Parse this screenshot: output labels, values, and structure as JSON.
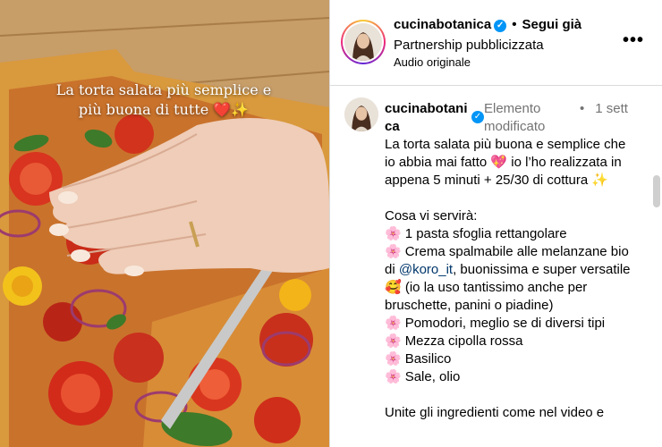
{
  "media": {
    "overlay_caption": "La torta salata più semplice e più buona di tutte ❤️✨"
  },
  "header": {
    "username": "cucinabotanica",
    "verified_icon": "✓",
    "separator": "•",
    "follow_label": "Segui già",
    "subtitle": "Partnership pubblicizzata",
    "audio": "Audio originale",
    "more_icon": "•••"
  },
  "comment": {
    "username": "cucinabotanica",
    "verified_icon": "✓",
    "edited": "Elemento modificato",
    "dot": "•",
    "time": "1 sett",
    "intro_1": "La torta salata più buona e semplice che io abbia mai fatto ",
    "intro_heart": "💖",
    "intro_2": " io l’ho realizzata in appena 5 minuti + 25/30 di cottura ",
    "intro_spark": "✨",
    "needs_title": "Cosa vi servirà:",
    "flower_icon": "🌸",
    "item_1": "1 pasta sfoglia rettangolare",
    "item_2a": "Crema spalmabile alle melanzane bio di ",
    "item_2_mention": "@koro_it",
    "item_2b": ", buonissima e super versatile ",
    "item_2_emoji": "🥰",
    "item_2c": " (io la uso tantissimo anche per bruschette, panini o piadine)",
    "item_3": "Pomodori, meglio se di diversi tipi",
    "item_4": "Mezza cipolla rossa",
    "item_5": "Basilico",
    "item_6": "Sale, olio",
    "outro": "Unite gli ingredienti come nel video e"
  }
}
